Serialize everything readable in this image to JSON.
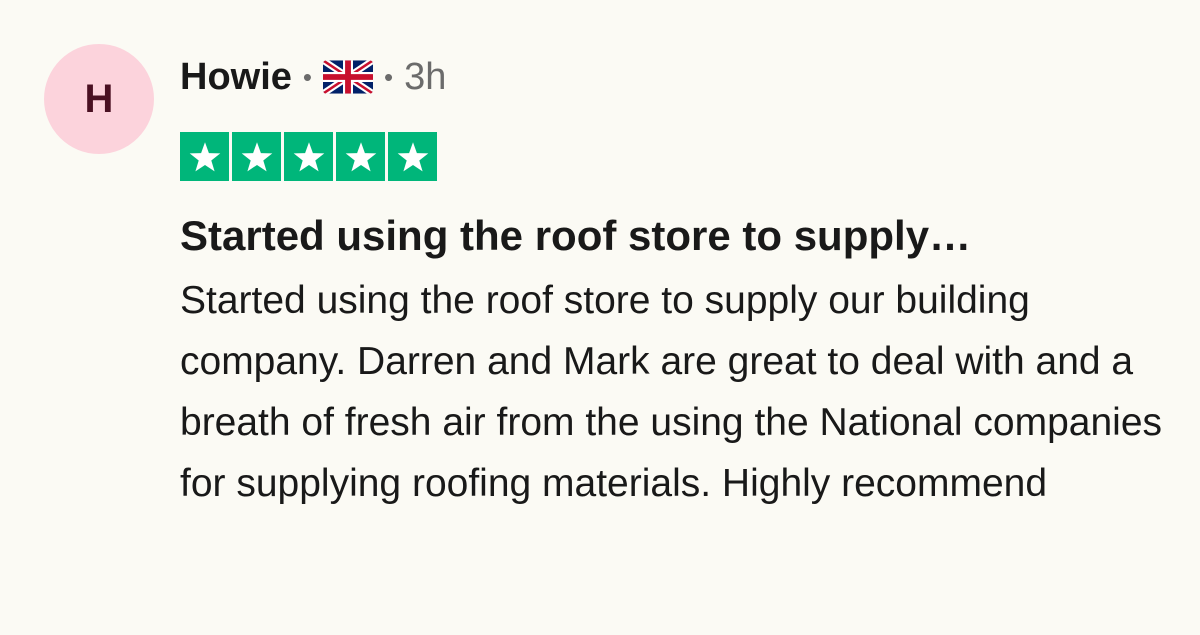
{
  "review": {
    "avatar_initial": "H",
    "author": "Howie",
    "separator": "•",
    "country_flag_icon": "uk-flag-icon",
    "time_ago": "3h",
    "rating": 5,
    "rating_max": 5,
    "star_color": "#00b67a",
    "title": "Started using the roof store to supply…",
    "body": "Started using the roof store to supply our building company. Darren and Mark are great to deal with and a breath of fresh air from the using the National companies for supplying roofing materials. Highly recommend"
  }
}
